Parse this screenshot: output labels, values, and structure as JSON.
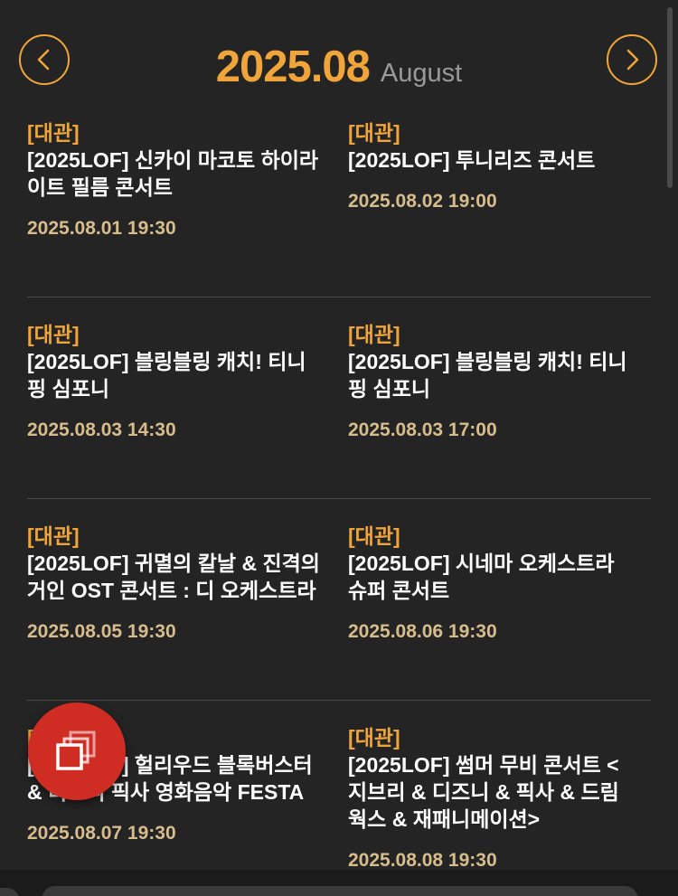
{
  "header": {
    "year_month": "2025.08",
    "month_name": "August",
    "prev_icon": "chevron-left-icon",
    "next_icon": "chevron-right-icon"
  },
  "colors": {
    "accent": "#f0a53a",
    "date": "#d7bd8c",
    "background": "#242424",
    "fab": "#cf2d24"
  },
  "events": [
    {
      "tag": "[대관]",
      "title": "[2025LOF] 신카이 마코토 하이라이트 필름 콘서트",
      "date": "2025.08.01 19:30"
    },
    {
      "tag": "[대관]",
      "title": "[2025LOF] 투니리즈 콘서트",
      "date": "2025.08.02 19:00"
    },
    {
      "tag": "[대관]",
      "title": "[2025LOF] 블링블링 캐치! 티니핑 심포니",
      "date": "2025.08.03 14:30"
    },
    {
      "tag": "[대관]",
      "title": "[2025LOF] 블링블링 캐치! 티니핑 심포니",
      "date": "2025.08.03 17:00"
    },
    {
      "tag": "[대관]",
      "title": "[2025LOF] 귀멸의 칼날 & 진격의 거인 OST 콘서트 : 디 오케스트라",
      "date": "2025.08.05 19:30"
    },
    {
      "tag": "[대관]",
      "title": "[2025LOF] 시네마 오케스트라 슈퍼 콘서트",
      "date": "2025.08.06 19:30"
    },
    {
      "tag": "[대관]",
      "title": "[2025LOF] 헐리우드 블록버스터 & 디즈니 픽사 영화음악 FESTA",
      "date": "2025.08.07 19:30"
    },
    {
      "tag": "[대관]",
      "title": "[2025LOF] 썸머 무비 콘서트 < 지브리 & 디즈니 & 픽사 & 드림웍스 & 재패니메이션>",
      "date": "2025.08.08 19:30"
    }
  ],
  "fab": {
    "icon": "copy-windows-icon"
  }
}
